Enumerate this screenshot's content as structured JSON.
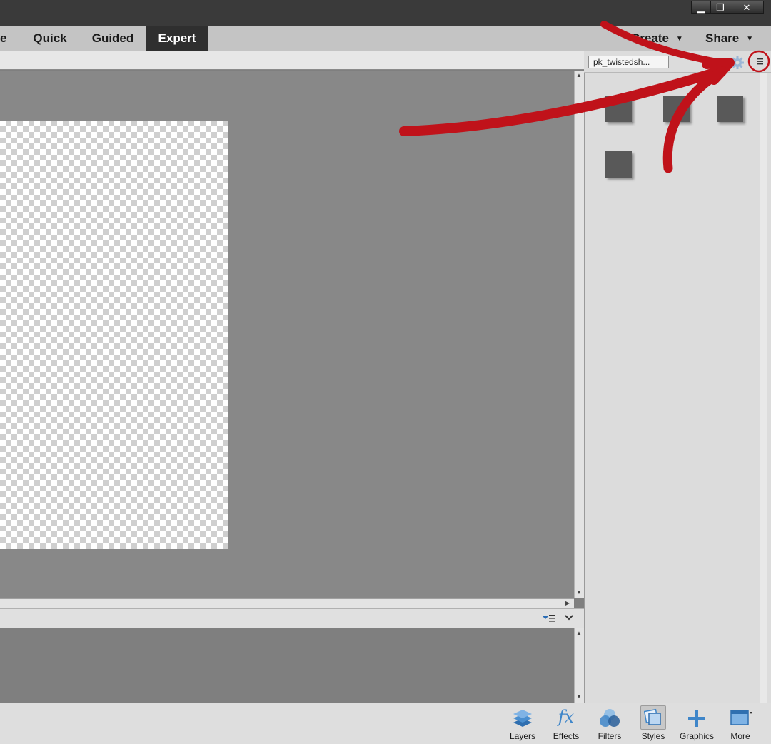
{
  "window_controls": {
    "minimize": "▁",
    "restore": "❐",
    "close": "✕"
  },
  "mode_tabs": [
    {
      "label": "e"
    },
    {
      "label": "Quick"
    },
    {
      "label": "Guided"
    },
    {
      "label": "Expert",
      "active": true
    }
  ],
  "menus": {
    "create": "Create",
    "share": "Share"
  },
  "panel": {
    "library_select": "pk_twistedsh...",
    "menu_icon": "panel-menu-icon",
    "settings_icon": "gear-icon",
    "swatch_count": 4
  },
  "bin_header_icons": [
    "bin-options-icon",
    "collapse-chevron-icon"
  ],
  "bottom_tools": [
    {
      "label": "Layers",
      "icon": "layers-icon"
    },
    {
      "label": "Effects",
      "icon": "fx-icon"
    },
    {
      "label": "Filters",
      "icon": "filters-icon"
    },
    {
      "label": "Styles",
      "icon": "styles-icon",
      "selected": true
    },
    {
      "label": "Graphics",
      "icon": "plus-icon"
    },
    {
      "label": "More",
      "icon": "more-window-icon"
    }
  ],
  "colors": {
    "accent_annotation": "#c0121a",
    "active_tab": "#2f2f2f",
    "icon_blue": "#3f86c9"
  }
}
